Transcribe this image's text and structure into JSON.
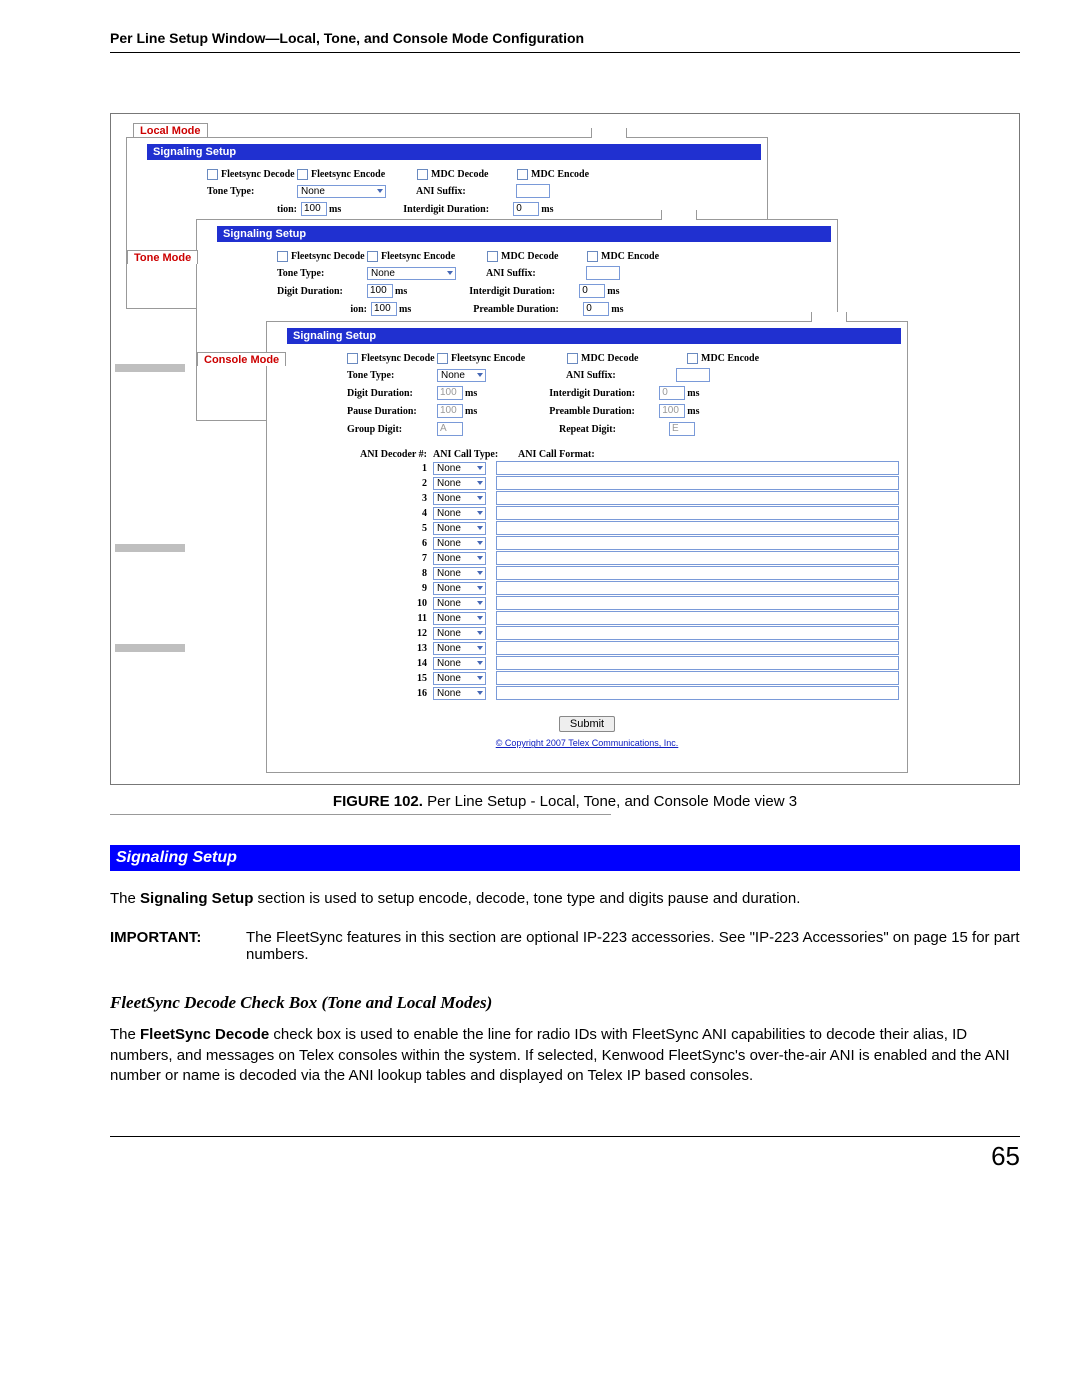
{
  "header": {
    "running_title": "Per Line Setup Window—Local, Tone, and Console Mode Configuration"
  },
  "figure": {
    "caption_prefix": "FIGURE 102.",
    "caption_text": "Per Line Setup - Local, Tone, and Console Mode view 3",
    "copyright": "© Copyright 2007 Telex Communications, Inc."
  },
  "common_labels": {
    "signaling_setup": "Signaling Setup",
    "fleetsync_decode": "Fleetsync Decode",
    "fleetsync_encode": "Fleetsync Encode",
    "mdc_decode": "MDC Decode",
    "mdc_encode": "MDC Encode",
    "tone_type": "Tone Type:",
    "ani_suffix": "ANI Suffix:",
    "digit_duration": "Digit Duration:",
    "interdigit_duration": "Interdigit Duration:",
    "pause_duration": "Pause Duration:",
    "preamble_duration": "Preamble Duration:",
    "group_digit": "Group Digit:",
    "repeat_digit": "Repeat Digit:",
    "ms": "ms",
    "submit": "Submit",
    "ani_decoder_num": "ANI Decoder #:",
    "ani_call_type": "ANI Call Type:",
    "ani_call_format": "ANI Call Format:"
  },
  "panels": {
    "local": {
      "tab": "Local Mode",
      "tone_type_value": "None",
      "digit_duration_value": "100",
      "ani_suffix_value": "",
      "interdigit_value": "0",
      "partial_label_1": "Tone Type:",
      "partial_label_2": "tion:"
    },
    "tone": {
      "tab": "Tone Mode",
      "tone_type_value": "None",
      "digit_duration_value": "100",
      "partial_ion": "ion:",
      "ion_value": "100",
      "interdigit_value": "0",
      "preamble_value": "0"
    },
    "console": {
      "tab": "Console Mode",
      "tone_type_value": "None",
      "digit_duration_value": "100",
      "pause_duration_value": "100",
      "group_digit_value": "A",
      "interdigit_value": "0",
      "preamble_value": "100",
      "repeat_digit_value": "E",
      "decoder_rows": [
        "1",
        "2",
        "3",
        "4",
        "5",
        "6",
        "7",
        "8",
        "9",
        "10",
        "11",
        "12",
        "13",
        "14",
        "15",
        "16"
      ],
      "call_type_value": "None"
    }
  },
  "section": {
    "heading": "Signaling Setup",
    "intro_pre": "The ",
    "intro_bold": "Signaling Setup",
    "intro_post": " section is used to setup encode, decode, tone type and digits pause and duration.",
    "important_label": "IMPORTANT:",
    "important_text": "The FleetSync features in this section are optional IP-223 accessories. See \"IP-223 Accessories\" on page 15 for part numbers.",
    "sub_heading": "FleetSync Decode Check Box (Tone and Local Modes)",
    "para2_pre": "The ",
    "para2_bold": "FleetSync Decode",
    "para2_post": " check box is used to enable the line for radio IDs with FleetSync ANI capabilities to decode their alias, ID numbers, and messages on Telex consoles within the system. If selected, Kenwood FleetSync's over-the-air ANI is enabled and the ANI number or name is decoded via the ANI lookup tables and displayed on Telex IP based consoles."
  },
  "page_number": "65"
}
